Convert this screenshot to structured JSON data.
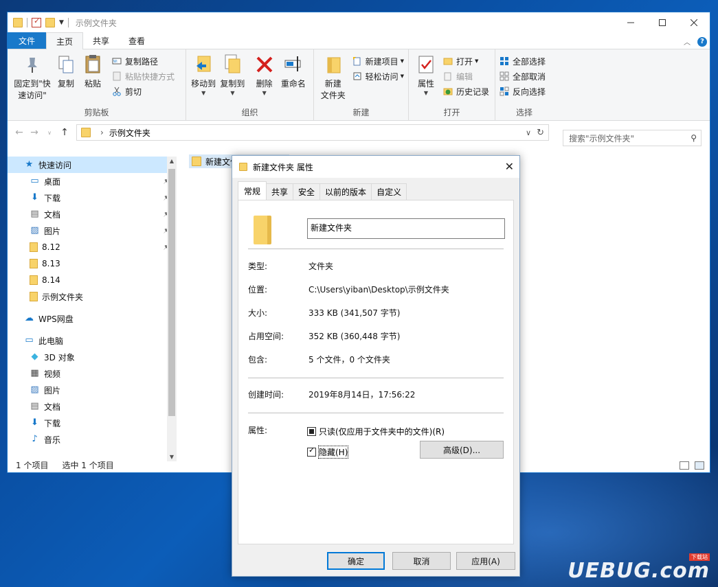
{
  "explorer": {
    "title": "示例文件夹",
    "window_controls": [
      "minimize",
      "maximize",
      "close"
    ],
    "menu_tabs": [
      "文件",
      "主页",
      "共享",
      "查看"
    ],
    "active_tab": "主页",
    "ribbon": {
      "clipboard": {
        "label": "剪贴板",
        "pin_quick_access": "固定到\"快速访问\"",
        "copy": "复制",
        "paste": "粘贴",
        "copy_path": "复制路径",
        "paste_shortcut": "粘贴快捷方式",
        "cut": "剪切"
      },
      "organize": {
        "label": "组织",
        "move_to": "移动到",
        "copy_to": "复制到",
        "delete": "删除",
        "rename": "重命名"
      },
      "new": {
        "label": "新建",
        "new_folder": "新建\n文件夹",
        "new_item": "新建项目",
        "easy_access": "轻松访问"
      },
      "open": {
        "label": "打开",
        "properties": "属性",
        "open": "打开",
        "edit": "编辑",
        "history": "历史记录"
      },
      "select": {
        "label": "选择",
        "select_all": "全部选择",
        "select_none": "全部取消",
        "invert_selection": "反向选择"
      }
    },
    "address": {
      "crumb": "示例文件夹"
    },
    "search": {
      "placeholder": "搜索\"示例文件夹\""
    },
    "nav": [
      {
        "label": "快速访问",
        "icon": "star-icon",
        "level": 0,
        "selected": true,
        "pinned": false
      },
      {
        "label": "桌面",
        "icon": "desktop-icon",
        "level": 1,
        "pinned": true
      },
      {
        "label": "下载",
        "icon": "download-icon",
        "level": 1,
        "pinned": true
      },
      {
        "label": "文档",
        "icon": "document-icon",
        "level": 1,
        "pinned": true
      },
      {
        "label": "图片",
        "icon": "picture-icon",
        "level": 1,
        "pinned": true
      },
      {
        "label": "8.12",
        "icon": "folder-icon",
        "level": 1,
        "pinned": true
      },
      {
        "label": "8.13",
        "icon": "folder-icon",
        "level": 1,
        "pinned": false
      },
      {
        "label": "8.14",
        "icon": "folder-icon",
        "level": 1,
        "pinned": false
      },
      {
        "label": "示例文件夹",
        "icon": "folder-icon",
        "level": 1,
        "pinned": false
      },
      {
        "label": "WPS网盘",
        "icon": "cloud-icon",
        "level": 0,
        "pinned": false
      },
      {
        "label": "此电脑",
        "icon": "computer-icon",
        "level": 0,
        "pinned": false
      },
      {
        "label": "3D 对象",
        "icon": "cube-icon",
        "level": 1,
        "pinned": false
      },
      {
        "label": "视频",
        "icon": "video-icon",
        "level": 1,
        "pinned": false
      },
      {
        "label": "图片",
        "icon": "picture-icon",
        "level": 1,
        "pinned": false
      },
      {
        "label": "文档",
        "icon": "document-icon",
        "level": 1,
        "pinned": false
      },
      {
        "label": "下载",
        "icon": "download-icon",
        "level": 1,
        "pinned": false
      },
      {
        "label": "音乐",
        "icon": "music-icon",
        "level": 1,
        "pinned": false
      }
    ],
    "content": {
      "item_name": "新建文件"
    },
    "status": {
      "count": "1 个项目",
      "selected": "选中 1 个项目"
    }
  },
  "dialog": {
    "title": "新建文件夹 属性",
    "tabs": [
      "常规",
      "共享",
      "安全",
      "以前的版本",
      "自定义"
    ],
    "active_tab": "常规",
    "name": "新建文件夹",
    "rows": [
      {
        "label": "类型:",
        "value": "文件夹"
      },
      {
        "label": "位置:",
        "value": "C:\\Users\\yiban\\Desktop\\示例文件夹"
      },
      {
        "label": "大小:",
        "value": "333 KB (341,507 字节)"
      },
      {
        "label": "占用空间:",
        "value": "352 KB (360,448 字节)"
      },
      {
        "label": "包含:",
        "value": "5 个文件，0 个文件夹"
      }
    ],
    "created_label": "创建时间:",
    "created_value": "2019年8月14日，17:56:22",
    "attributes_label": "属性:",
    "readonly_label": "只读(仅应用于文件夹中的文件)(R)",
    "readonly_state": "indeterminate",
    "hidden_label": "隐藏(H)",
    "hidden_state": "checked",
    "advanced_button": "高级(D)...",
    "ok": "确定",
    "cancel": "取消",
    "apply": "应用(A)"
  },
  "watermark": {
    "text": "UEBUG.com",
    "tag": "下载站"
  },
  "colors": {
    "accent": "#1979ca",
    "selection": "#cce8ff",
    "folder": "#f8d36a"
  }
}
